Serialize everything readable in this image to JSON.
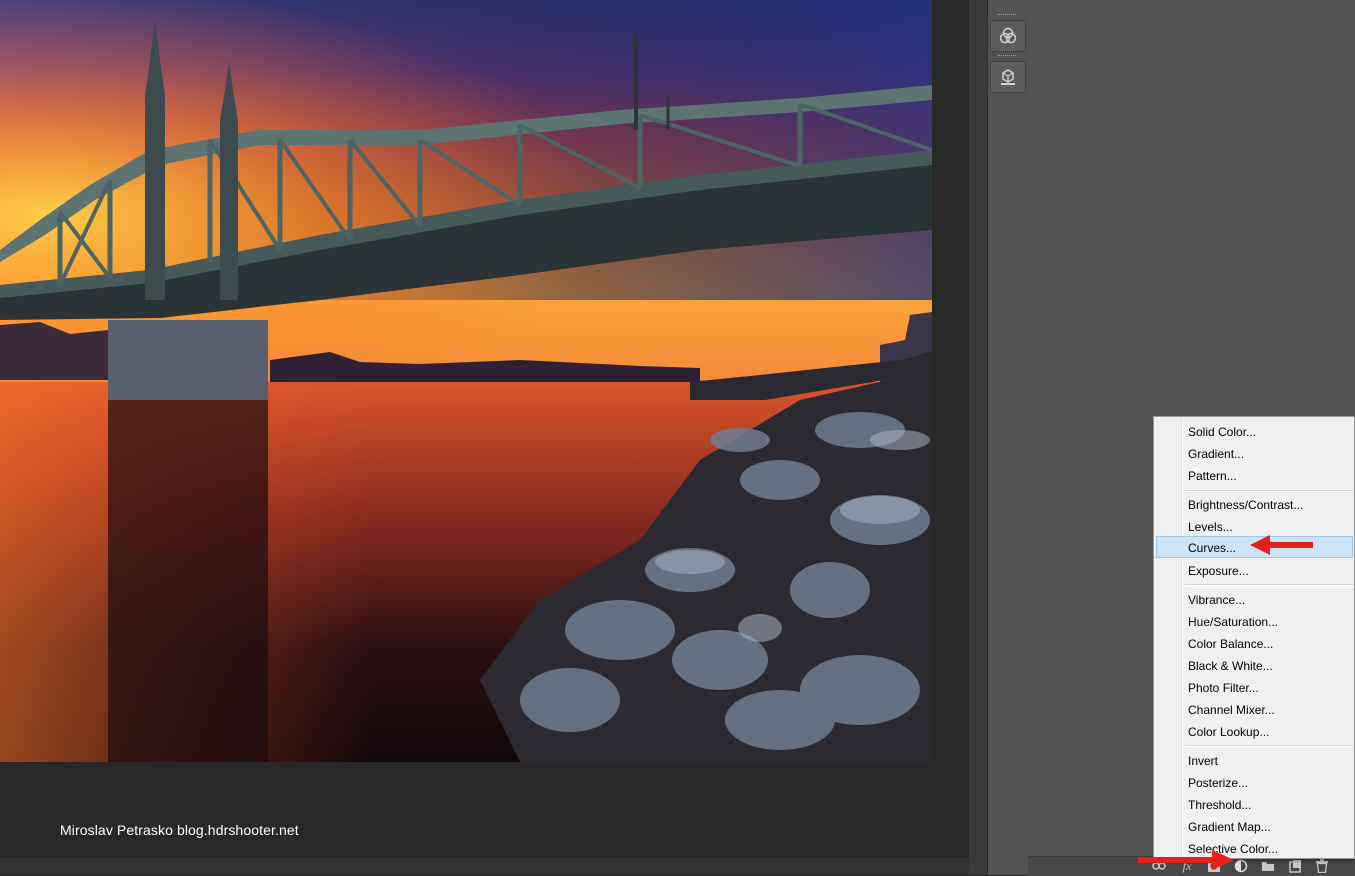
{
  "watermark": {
    "text": "Miroslav  Petrasko  blog.hdrshooter.net"
  },
  "colors": {
    "accent_arrow": "#e8201c",
    "menu_highlight": "#cde4f7",
    "menu_bg": "#f0f0f0"
  },
  "tools": [
    {
      "icon": "channels-icon"
    },
    {
      "icon": "3d-cube-icon"
    }
  ],
  "adjustment_menu": {
    "groups": [
      [
        "Solid Color...",
        "Gradient...",
        "Pattern..."
      ],
      [
        "Brightness/Contrast...",
        "Levels...",
        "Curves...",
        "Exposure..."
      ],
      [
        "Vibrance...",
        "Hue/Saturation...",
        "Color Balance...",
        "Black & White...",
        "Photo Filter...",
        "Channel Mixer...",
        "Color Lookup..."
      ],
      [
        "Invert",
        "Posterize...",
        "Threshold...",
        "Gradient Map...",
        "Selective Color..."
      ]
    ],
    "highlighted": "Curves..."
  },
  "layers_panel_footer": {
    "icons": [
      "link-layers-icon",
      "fx-icon",
      "add-mask-icon",
      "adjustment-layer-icon",
      "new-group-icon",
      "new-layer-icon",
      "trash-icon"
    ],
    "fx_label": "fx"
  }
}
